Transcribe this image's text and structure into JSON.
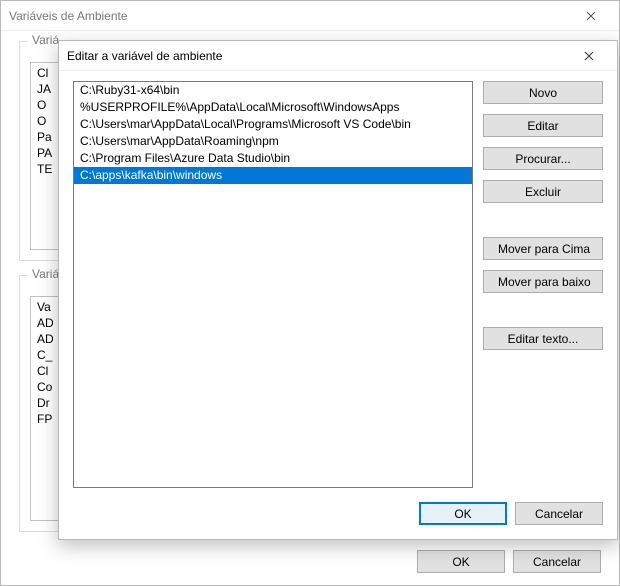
{
  "parent": {
    "title": "Variáveis de Ambiente",
    "group1_label": "Variá",
    "group2_label": "Variá",
    "bg_list1": [
      "Cl",
      "JA",
      "O",
      "O",
      "Pa",
      "PA",
      "TE"
    ],
    "bg_list2": [
      "Va",
      "AD",
      "AD",
      "C_",
      "Cl",
      "Co",
      "Dr",
      "FP"
    ],
    "ok": "OK",
    "cancel": "Cancelar"
  },
  "modal": {
    "title": "Editar a variável de ambiente",
    "paths": [
      "C:\\Ruby31-x64\\bin",
      "%USERPROFILE%\\AppData\\Local\\Microsoft\\WindowsApps",
      "C:\\Users\\mar\\AppData\\Local\\Programs\\Microsoft VS Code\\bin",
      "C:\\Users\\mar\\AppData\\Roaming\\npm",
      "C:\\Program Files\\Azure Data Studio\\bin",
      "C:\\apps\\kafka\\bin\\windows"
    ],
    "selected_index": 5,
    "buttons": {
      "new": "Novo",
      "edit": "Editar",
      "browse": "Procurar...",
      "delete": "Excluir",
      "move_up": "Mover para Cima",
      "move_down": "Mover para baixo",
      "edit_text": "Editar texto..."
    },
    "ok": "OK",
    "cancel": "Cancelar"
  }
}
